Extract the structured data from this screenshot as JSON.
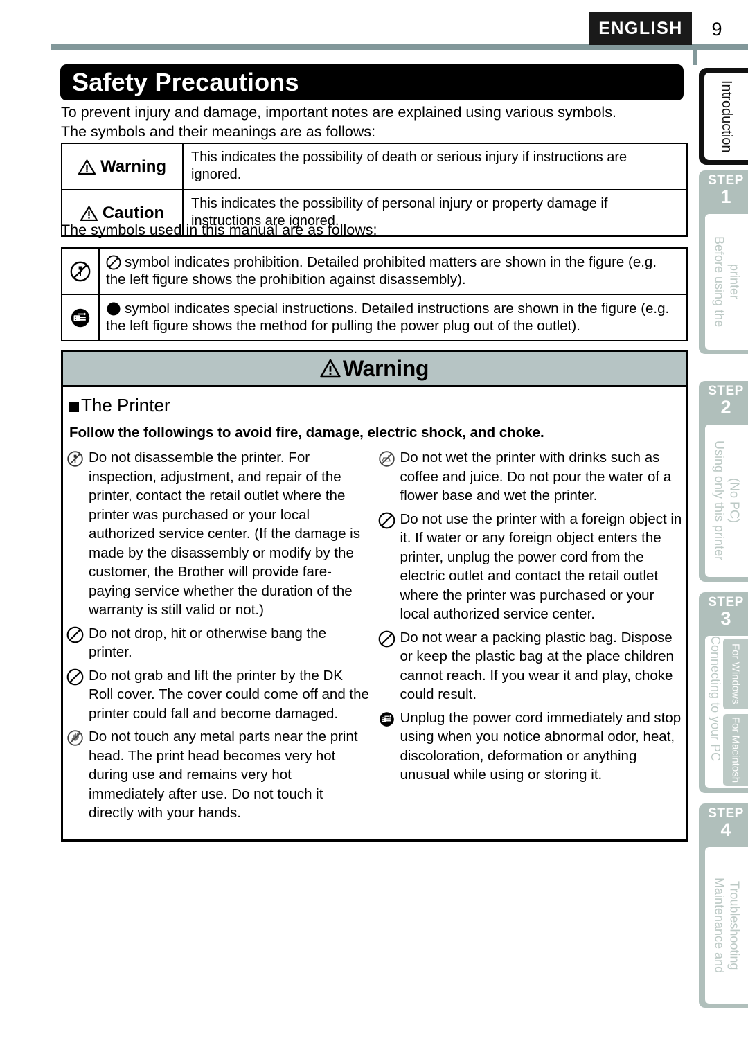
{
  "header": {
    "language_badge": "ENGLISH",
    "page_number": "9"
  },
  "title": "Safety Precautions",
  "intro": {
    "line1": "To prevent injury and damage, important notes are explained using various symbols.",
    "line2": "The symbols and their meanings are as follows:"
  },
  "meaning_table": {
    "rows": [
      {
        "icon": "warning-triangle-icon",
        "label": "Warning",
        "description": "This indicates the possibility of death or serious injury if instructions are ignored."
      },
      {
        "icon": "caution-triangle-icon",
        "label": "Caution",
        "description": "This indicates the possibility of personal injury or property damage if instructions are ignored."
      }
    ]
  },
  "symbols_intro": "The symbols used in this manual are as follows:",
  "symbol_table": {
    "rows": [
      {
        "left_icon": "no-disassembly-icon",
        "inline_icon": "prohibition-circle-icon",
        "description": "symbol indicates prohibition. Detailed prohibited matters are shown in the figure (e.g. the left figure shows the prohibition against disassembly)."
      },
      {
        "left_icon": "unplug-power-plug-icon",
        "inline_icon": "filled-circle-icon",
        "description": "symbol indicates special instructions. Detailed instructions are shown in the figure (e.g. the left figure shows the method for pulling the power plug out of the outlet)."
      }
    ]
  },
  "warning_box": {
    "banner_label": "Warning",
    "banner_icon": "warning-triangle-icon",
    "section_heading": "The Printer",
    "section_subheading": "Follow the followings to avoid fire, damage, electric shock, and choke.",
    "left_column": [
      {
        "icon": "no-disassembly-icon",
        "text": "Do not disassemble the printer. For inspection, adjustment, and repair of the printer, contact the retail outlet where the printer was purchased or your local authorized service center. (If the damage is made by the disassembly or modify by the customer, the Brother will provide fare-paying service whether the duration of the warranty is still valid or not.)"
      },
      {
        "icon": "prohibition-circle-icon",
        "text": "Do not drop, hit or otherwise bang the printer."
      },
      {
        "icon": "prohibition-circle-icon",
        "text": "Do not grab and lift the printer by the DK Roll cover. The cover could come off and the printer could fall and become damaged."
      },
      {
        "icon": "no-touch-hand-icon",
        "text": "Do not touch any metal parts near the print head. The print head becomes very hot during use and remains very hot immediately after use. Do not touch it directly with your hands."
      }
    ],
    "right_column": [
      {
        "icon": "no-liquid-icon",
        "text": "Do not wet the printer with drinks such as coffee and juice. Do not pour the water of a flower base and wet the printer."
      },
      {
        "icon": "prohibition-circle-icon",
        "text": "Do not use the printer with a foreign object in it. If water or any foreign object enters the printer, unplug the power cord from the electric outlet and contact the retail outlet where the printer was purchased or your local authorized service center."
      },
      {
        "icon": "prohibition-circle-icon",
        "text": "Do not wear a packing plastic bag. Dispose or keep the plastic bag at the place children cannot reach. If you wear it and play, choke could result."
      },
      {
        "icon": "unplug-power-plug-icon",
        "text": "Unplug the power cord immediately and stop using when you notice abnormal odor, heat, discoloration, deformation or anything unusual while using or storing it."
      }
    ]
  },
  "sidebar": {
    "tabs": [
      {
        "type": "active",
        "label": "Introduction",
        "step_word": "",
        "step_number": ""
      },
      {
        "type": "step",
        "step_word": "STEP",
        "step_number": "1",
        "label_line1": "Before using the",
        "label_line2": "printer"
      },
      {
        "type": "step",
        "step_word": "STEP",
        "step_number": "2",
        "label_line1": "Using only this printer",
        "label_line2": "(No PC)"
      },
      {
        "type": "step",
        "step_word": "STEP",
        "step_number": "3",
        "label_line1": "Connecting to your PC",
        "sub_tabs": [
          "For Windows",
          "For Macintosh"
        ]
      },
      {
        "type": "step",
        "step_word": "STEP",
        "step_number": "4",
        "label_line1": "Maintenance and",
        "label_line2": "Troubleshooting"
      }
    ]
  },
  "colors": {
    "rule": "#82989a",
    "badge_bg": "#1a1a1a",
    "warning_banner_bg": "#b6c4c4",
    "sidebar_tab_bg": "#b0bfbb",
    "sidebar_text": "#c3cfcb"
  }
}
